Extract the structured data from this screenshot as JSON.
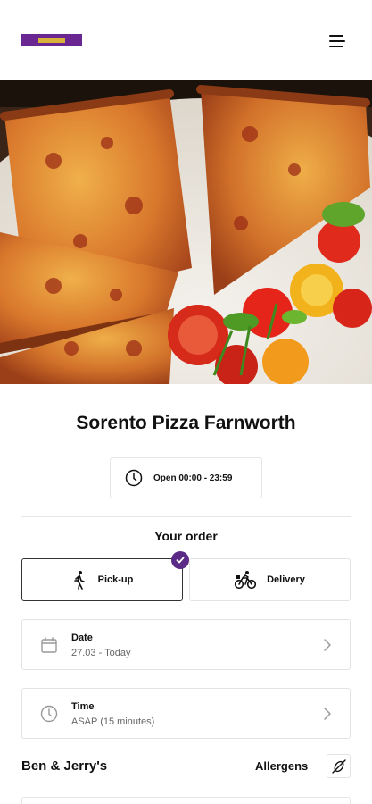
{
  "header": {
    "logo_icon": "brand-logo",
    "menu_icon": "hamburger-menu-icon",
    "brand_color": "#6a2791"
  },
  "hero": {
    "image_icon": "pizza-photo"
  },
  "store": {
    "name": "Sorento Pizza Farnworth",
    "hours_icon": "clock-icon",
    "hours": "Open 00:00 - 23:59"
  },
  "order": {
    "title": "Your order",
    "options": [
      {
        "label": "Pick-up",
        "icon": "walking-person-icon",
        "selected": true
      },
      {
        "label": "Delivery",
        "icon": "delivery-bike-icon",
        "selected": false
      }
    ],
    "selected_color": "#5b2a86",
    "date": {
      "label": "Date",
      "value": "27.03 - Today",
      "icon": "calendar-icon"
    },
    "time": {
      "label": "Time",
      "value": "ASAP (15 minutes)",
      "icon": "clock-icon"
    }
  },
  "menu_section": {
    "title": "Ben & Jerry's",
    "allergens_label": "Allergens",
    "allergens_icon": "allergen-no-nuts-icon"
  }
}
